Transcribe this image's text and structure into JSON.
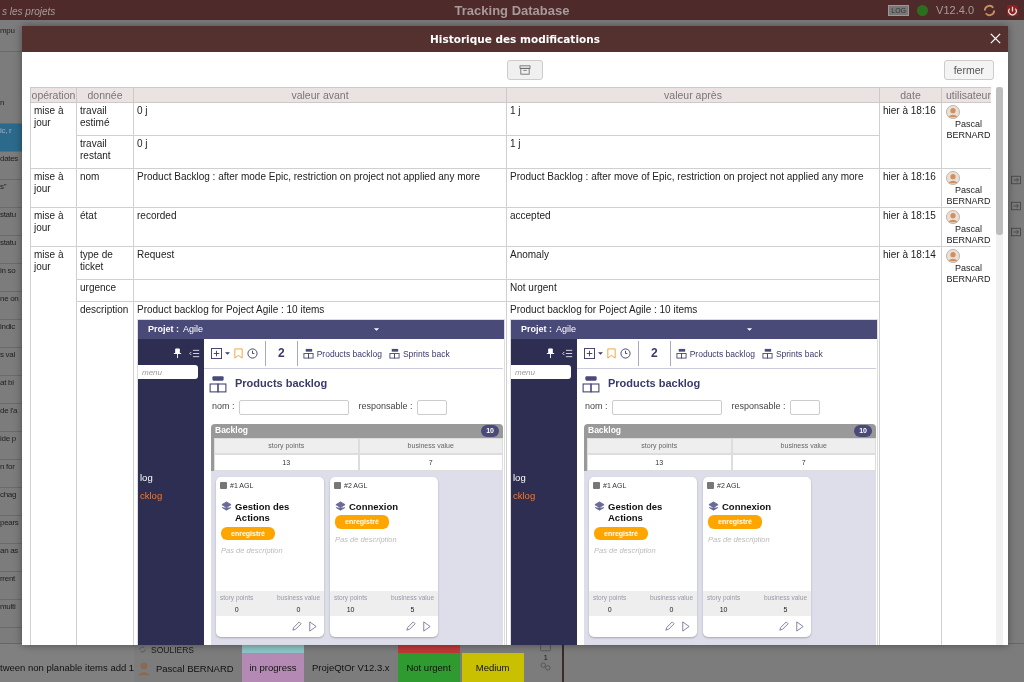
{
  "background": {
    "top_left": "s les projets",
    "app_title": "Tracking Database",
    "log_label": "LOG",
    "version": "V12.4.0",
    "left_items": [
      {
        "text": "mpu",
        "selected": false
      },
      {
        "text": "n",
        "selected": false
      },
      {
        "text": "ic, r",
        "selected": true
      },
      {
        "text": "dates",
        "selected": false
      },
      {
        "text": "s\"",
        "selected": false
      },
      {
        "text": "statu",
        "selected": false
      },
      {
        "text": "statu",
        "selected": false
      },
      {
        "text": "in so",
        "selected": false
      },
      {
        "text": "ne on",
        "selected": false
      },
      {
        "text": "indic",
        "selected": false
      },
      {
        "text": "s val",
        "selected": false
      },
      {
        "text": "at bi",
        "selected": false
      },
      {
        "text": "de l'a",
        "selected": false
      },
      {
        "text": "ide p",
        "selected": false
      },
      {
        "text": "n for",
        "selected": false
      },
      {
        "text": "chag",
        "selected": false
      },
      {
        "text": "pears",
        "selected": false
      },
      {
        "text": "an as",
        "selected": false
      },
      {
        "text": "rrent",
        "selected": false
      },
      {
        "text": "multi",
        "selected": false
      }
    ],
    "footer": {
      "left_text": "tween non planable items add 1",
      "project": "SOULIERS",
      "user": "Pascal BERNARD",
      "tags": [
        {
          "text": "in progress",
          "color": "#b48ab4",
          "strip": {
            "color": "#8cc4c4"
          }
        },
        {
          "text": "ProjeQtOr V12.3.x"
        },
        {
          "text": "Not urgent",
          "color": "#2f9a2f",
          "strip": {
            "color": "#c03838"
          }
        },
        {
          "text": "Medium",
          "color": "#c8c000"
        }
      ],
      "count": "1"
    }
  },
  "dialog": {
    "title": "Historique des modifications",
    "close_label": "fermer",
    "columns": [
      "opération",
      "donnée",
      "valeur avant",
      "valeur après",
      "date",
      "utilisateur"
    ],
    "history": [
      {
        "operation": "mise à jour",
        "date": "hier à 18:16",
        "user": "Pascal BERNARD",
        "changes": [
          {
            "kind": "text",
            "field": "travail estimé",
            "before": "0 j",
            "after": "1 j"
          },
          {
            "kind": "text",
            "field": "travail restant",
            "before": "0 j",
            "after": "1 j"
          }
        ]
      },
      {
        "operation": "mise à jour",
        "date": "hier à 18:16",
        "user": "Pascal BERNARD",
        "changes": [
          {
            "kind": "text",
            "field": "nom",
            "before": "Product Backlog : after mode Epic, restriction on project not applied any more",
            "after": "Product Backlog : after move of Epic, restriction on project not applied any more"
          }
        ]
      },
      {
        "operation": "mise à jour",
        "date": "hier à 18:15",
        "user": "Pascal BERNARD",
        "changes": [
          {
            "kind": "text",
            "field": "état",
            "before": "recorded",
            "after": "accepted"
          }
        ]
      },
      {
        "operation": "mise à jour",
        "date": "hier à 18:14",
        "user": "Pascal BERNARD",
        "changes": [
          {
            "kind": "text",
            "field": "type de ticket",
            "before": "Request",
            "after": "Anomaly"
          },
          {
            "kind": "text",
            "field": "urgence",
            "after": "Not urgent"
          },
          {
            "kind": "description",
            "field": "description",
            "before": "Product backlog for Poject Agile : 10 items",
            "after": "Product backlog for Poject Agile : 10 items",
            "before_screenshot": {
              "project_label": "Projet :",
              "project": "Agile",
              "menu_placeholder": "menu",
              "menu_items": [
                {
                  "label": "log",
                  "selected": false
                },
                {
                  "label": "cklog",
                  "selected": true
                }
              ],
              "count": "2",
              "tabs": [
                "Products backlog",
                "Sprints back"
              ],
              "title": "Products backlog",
              "filters": [
                "nom :",
                "responsable :"
              ],
              "panel_title": "Backlog",
              "badge": "10",
              "columns": [
                "story points",
                "business value"
              ],
              "totals": [
                "13",
                "7"
              ],
              "cards": [
                {
                  "id": "#1 AGL",
                  "title": "Gestion des Actions",
                  "status": "enregistré",
                  "description": "Pas de description",
                  "stats": [
                    {
                      "label": "story points",
                      "value": "0"
                    },
                    {
                      "label": "business value",
                      "value": "0"
                    }
                  ]
                },
                {
                  "id": "#2 AGL",
                  "title": "Connexion",
                  "status": "enregistré",
                  "description": "Pas de description",
                  "stats": [
                    {
                      "label": "story points",
                      "value": "10"
                    },
                    {
                      "label": "business value",
                      "value": "5"
                    }
                  ]
                }
              ]
            },
            "after_screenshot": {
              "project_label": "Projet :",
              "project": "Agile",
              "menu_placeholder": "menu",
              "menu_items": [
                {
                  "label": "log",
                  "selected": false
                },
                {
                  "label": "cklog",
                  "selected": true
                }
              ],
              "count": "2",
              "tabs": [
                "Products backlog",
                "Sprints back"
              ],
              "title": "Products backlog",
              "filters": [
                "nom :",
                "responsable :"
              ],
              "panel_title": "Backlog",
              "badge": "10",
              "columns": [
                "story points",
                "business value"
              ],
              "totals": [
                "13",
                "7"
              ],
              "cards": [
                {
                  "id": "#1 AGL",
                  "title": "Gestion des Actions",
                  "status": "enregistré",
                  "description": "Pas de description",
                  "stats": [
                    {
                      "label": "story points",
                      "value": "0"
                    },
                    {
                      "label": "business value",
                      "value": "0"
                    }
                  ]
                },
                {
                  "id": "#2 AGL",
                  "title": "Connexion",
                  "status": "enregistré",
                  "description": "Pas de description",
                  "stats": [
                    {
                      "label": "story points",
                      "value": "10"
                    },
                    {
                      "label": "business value",
                      "value": "5"
                    }
                  ]
                }
              ]
            }
          }
        ]
      }
    ]
  }
}
